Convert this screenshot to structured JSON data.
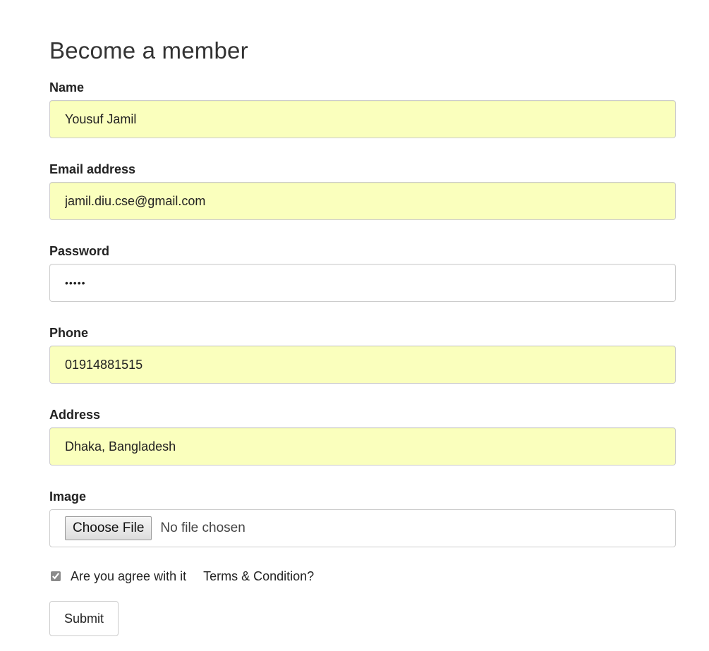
{
  "form": {
    "title": "Become a member",
    "name": {
      "label": "Name",
      "value": "Yousuf Jamil"
    },
    "email": {
      "label": "Email address",
      "value": "jamil.diu.cse@gmail.com"
    },
    "password": {
      "label": "Password",
      "value": "•••••"
    },
    "phone": {
      "label": "Phone",
      "value": "01914881515"
    },
    "address": {
      "label": "Address",
      "value": "Dhaka, Bangladesh"
    },
    "image": {
      "label": "Image",
      "button_label": "Choose File",
      "status": "No file chosen"
    },
    "agree": {
      "label": "Are you agree with it",
      "link": "Terms & Condition?",
      "checked": true
    },
    "submit_label": "Submit"
  },
  "colors": {
    "autofill_bg": "#faffbd",
    "border": "#cccccc",
    "text": "#333333"
  }
}
